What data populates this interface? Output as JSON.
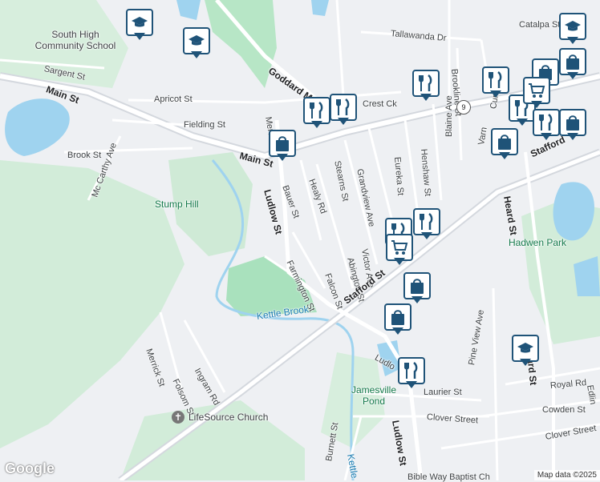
{
  "streets": {
    "main_st_west": "Main St",
    "main_st_center": "Main St",
    "sargent_st": "Sargent St",
    "apricot_st": "Apricot St",
    "fielding_st": "Fielding St",
    "brook_st": "Brook St",
    "mccarthy_ave": "Mc Carthy Ave",
    "goddard_memorial": "Goddard Mem",
    "crest_ck": "Crest Ck",
    "merchant": "Merch",
    "ludlow_st_north": "Ludlow St",
    "bauer_st": "Bauer St",
    "healy_rd": "Healy Rd",
    "stearns_st": "Stearns St",
    "grandview_ave": "Grandview Ave",
    "eureka_st": "Eureka St",
    "henshaw_st": "Henshaw St",
    "blaine_ave": "Blaine Ave",
    "brookline_st": "Brookline St",
    "tallawanda_dr": "Tallawanda Dr",
    "catalpa_st": "Catalpa St",
    "farmington_st": "Farmington St",
    "falcon_st": "Falcon St",
    "abington_st": "Abington St",
    "victor_ave": "Victor Ave",
    "stafford_st_mid": "Stafford St",
    "stafford_st_ne": "Stafford",
    "heard_st_north": "Heard St",
    "heard_st_south": "Heard St",
    "merrick_st": "Merrick St",
    "folsom_st": "Folsom St",
    "ingram_rd": "Ingram Rd",
    "ludlow_st_south": "Ludlow St",
    "ludlow_partial": "Ludlo",
    "laurier_st": "Laurier St",
    "clover_street": "Clover Street",
    "clover_street_east": "Clover Street",
    "pine_view_ave": "Pine View Ave",
    "royal_rd": "Royal Rd",
    "cowden_st": "Cowden St",
    "burnett_st": "Burnett St",
    "edlin": "Edlin",
    "varn": "Varn",
    "curt": "Curt"
  },
  "places": {
    "school": "South High Community School",
    "stump_hill": "Stump Hill",
    "hadwen_park": "Hadwen Park",
    "jamesville_pond": "Jamesville Pond",
    "kettle_brook": "Kettle Brook",
    "kettle_brook_south": "Kettle",
    "church": "LifeSource Church",
    "church_partial": "Bible Way Baptist Ch"
  },
  "route_shield": "9",
  "markers": [
    {
      "type": "school",
      "icon": "graduation-cap-icon"
    },
    {
      "type": "school",
      "icon": "graduation-cap-icon"
    },
    {
      "type": "school",
      "icon": "graduation-cap-icon"
    },
    {
      "type": "school",
      "icon": "graduation-cap-icon"
    },
    {
      "type": "restaurant",
      "icon": "fork-knife-icon"
    },
    {
      "type": "restaurant",
      "icon": "fork-knife-icon"
    },
    {
      "type": "shopping",
      "icon": "shopping-bag-icon"
    },
    {
      "type": "grocery",
      "icon": "shopping-cart-icon"
    }
  ],
  "footer": {
    "logo": "Google",
    "attribution": "Map data ©2025"
  },
  "colors": {
    "road": "#ffffff",
    "highway": "#d4d8de",
    "park": "#c6ebd1",
    "green_area": "#d2ecd9",
    "water": "#9fd3ef",
    "marker_border": "#1f5378",
    "background": "#eef0f3"
  }
}
